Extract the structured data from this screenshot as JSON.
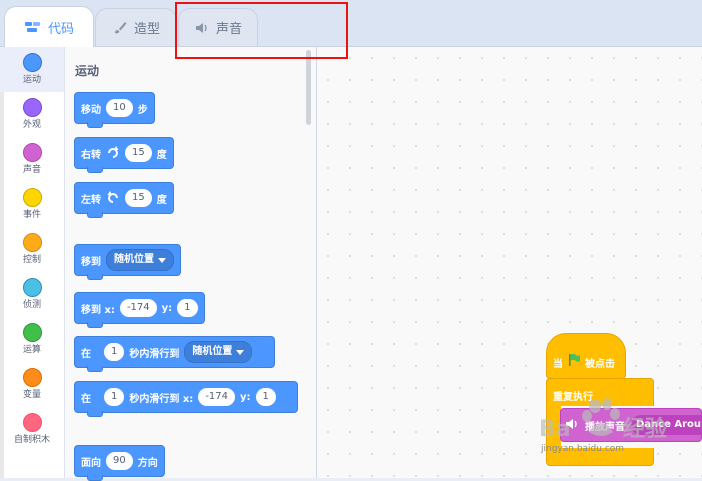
{
  "tabs": [
    {
      "label": "代码",
      "icon": "code-icon"
    },
    {
      "label": "造型",
      "icon": "brush-icon"
    },
    {
      "label": "声音",
      "icon": "speaker-icon"
    }
  ],
  "categories": [
    {
      "label": "运动",
      "color": "#4c97ff"
    },
    {
      "label": "外观",
      "color": "#9966ff"
    },
    {
      "label": "声音",
      "color": "#cf63cf"
    },
    {
      "label": "事件",
      "color": "#ffd500"
    },
    {
      "label": "控制",
      "color": "#ffab19"
    },
    {
      "label": "侦测",
      "color": "#4cbfe6"
    },
    {
      "label": "运算",
      "color": "#40bf4a"
    },
    {
      "label": "变量",
      "color": "#ff8c1a"
    },
    {
      "label": "自制积木",
      "color": "#ff6680"
    }
  ],
  "palette": {
    "section_title": "运动",
    "move": {
      "label": "移动",
      "value": "10",
      "unit": "步"
    },
    "turn_right": {
      "label": "右转",
      "value": "15",
      "unit": "度"
    },
    "turn_left": {
      "label": "左转",
      "value": "15",
      "unit": "度"
    },
    "goto": {
      "label": "移到",
      "dropdown": "随机位置"
    },
    "goto_xy": {
      "label": "移到 x:",
      "x": "-174",
      "ylabel": "y:",
      "y": "1"
    },
    "glide_to": {
      "label1": "在",
      "secs": "1",
      "label2": "秒内滑行到",
      "dropdown": "随机位置"
    },
    "glide_xy": {
      "label1": "在",
      "secs": "1",
      "label2": "秒内滑行到 x:",
      "x": "-174",
      "ylabel": "y:",
      "y": "1"
    },
    "point_dir": {
      "label": "面向",
      "value": "90",
      "unit": "方向"
    }
  },
  "workspace": {
    "hat": {
      "label1": "当",
      "label2": "被点击"
    },
    "loop": {
      "label": "重复执行"
    },
    "sound": {
      "label": "播放声音",
      "dropdown": "Dance Around"
    }
  },
  "watermark": {
    "text": "Baidu 经验",
    "site": "jingyan.baidu.com"
  },
  "colors": {
    "motion": "#4c97ff",
    "events": "#ffbf00",
    "sound": "#cf63cf",
    "highlight": "#ee1111"
  }
}
